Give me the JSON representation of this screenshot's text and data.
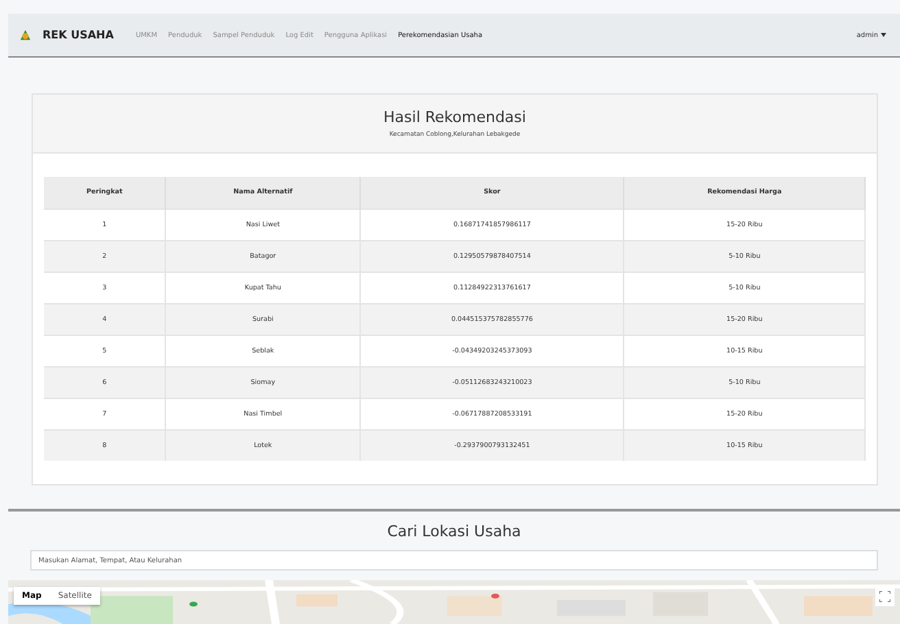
{
  "navbar": {
    "brand": "REK USAHA",
    "links": [
      {
        "label": "UMKM",
        "selected": false
      },
      {
        "label": "Penduduk",
        "selected": false
      },
      {
        "label": "Sampel Penduduk",
        "selected": false
      },
      {
        "label": "Log Edit",
        "selected": false
      },
      {
        "label": "Pengguna Aplikasi",
        "selected": false
      },
      {
        "label": "Perekomendasian Usaha",
        "selected": true
      }
    ],
    "user": "admin"
  },
  "result": {
    "title": "Hasil Rekomendasi",
    "subtitle": "Kecamatan Coblong,Kelurahan Lebakgede",
    "table": {
      "columns": [
        "Peringkat",
        "Nama Alternatif",
        "Skor",
        "Rekomendasi Harga"
      ],
      "rows": [
        [
          "1",
          "Nasi Liwet",
          "0.16871741857986117",
          "15-20 Ribu"
        ],
        [
          "2",
          "Batagor",
          "0.12950579878407514",
          "5-10 Ribu"
        ],
        [
          "3",
          "Kupat Tahu",
          "0.11284922313761617",
          "5-10 Ribu"
        ],
        [
          "4",
          "Surabi",
          "0.044515375782855776",
          "15-20 Ribu"
        ],
        [
          "5",
          "Seblak",
          "-0.04349203245373093",
          "10-15 Ribu"
        ],
        [
          "6",
          "Siomay",
          "-0.05112683243210023",
          "5-10 Ribu"
        ],
        [
          "7",
          "Nasi Timbel",
          "-0.06717887208533191",
          "15-20 Ribu"
        ],
        [
          "8",
          "Lotek",
          "-0.2937900793132451",
          "10-15 Ribu"
        ]
      ]
    }
  },
  "search": {
    "title": "Cari Lokasi Usaha",
    "placeholder": "Masukan Alamat, Tempat, Atau Kelurahan"
  },
  "map": {
    "kind": "picture",
    "map_types": [
      {
        "label": "Map",
        "selected": true
      },
      {
        "label": "Satellite",
        "selected": false
      }
    ]
  }
}
